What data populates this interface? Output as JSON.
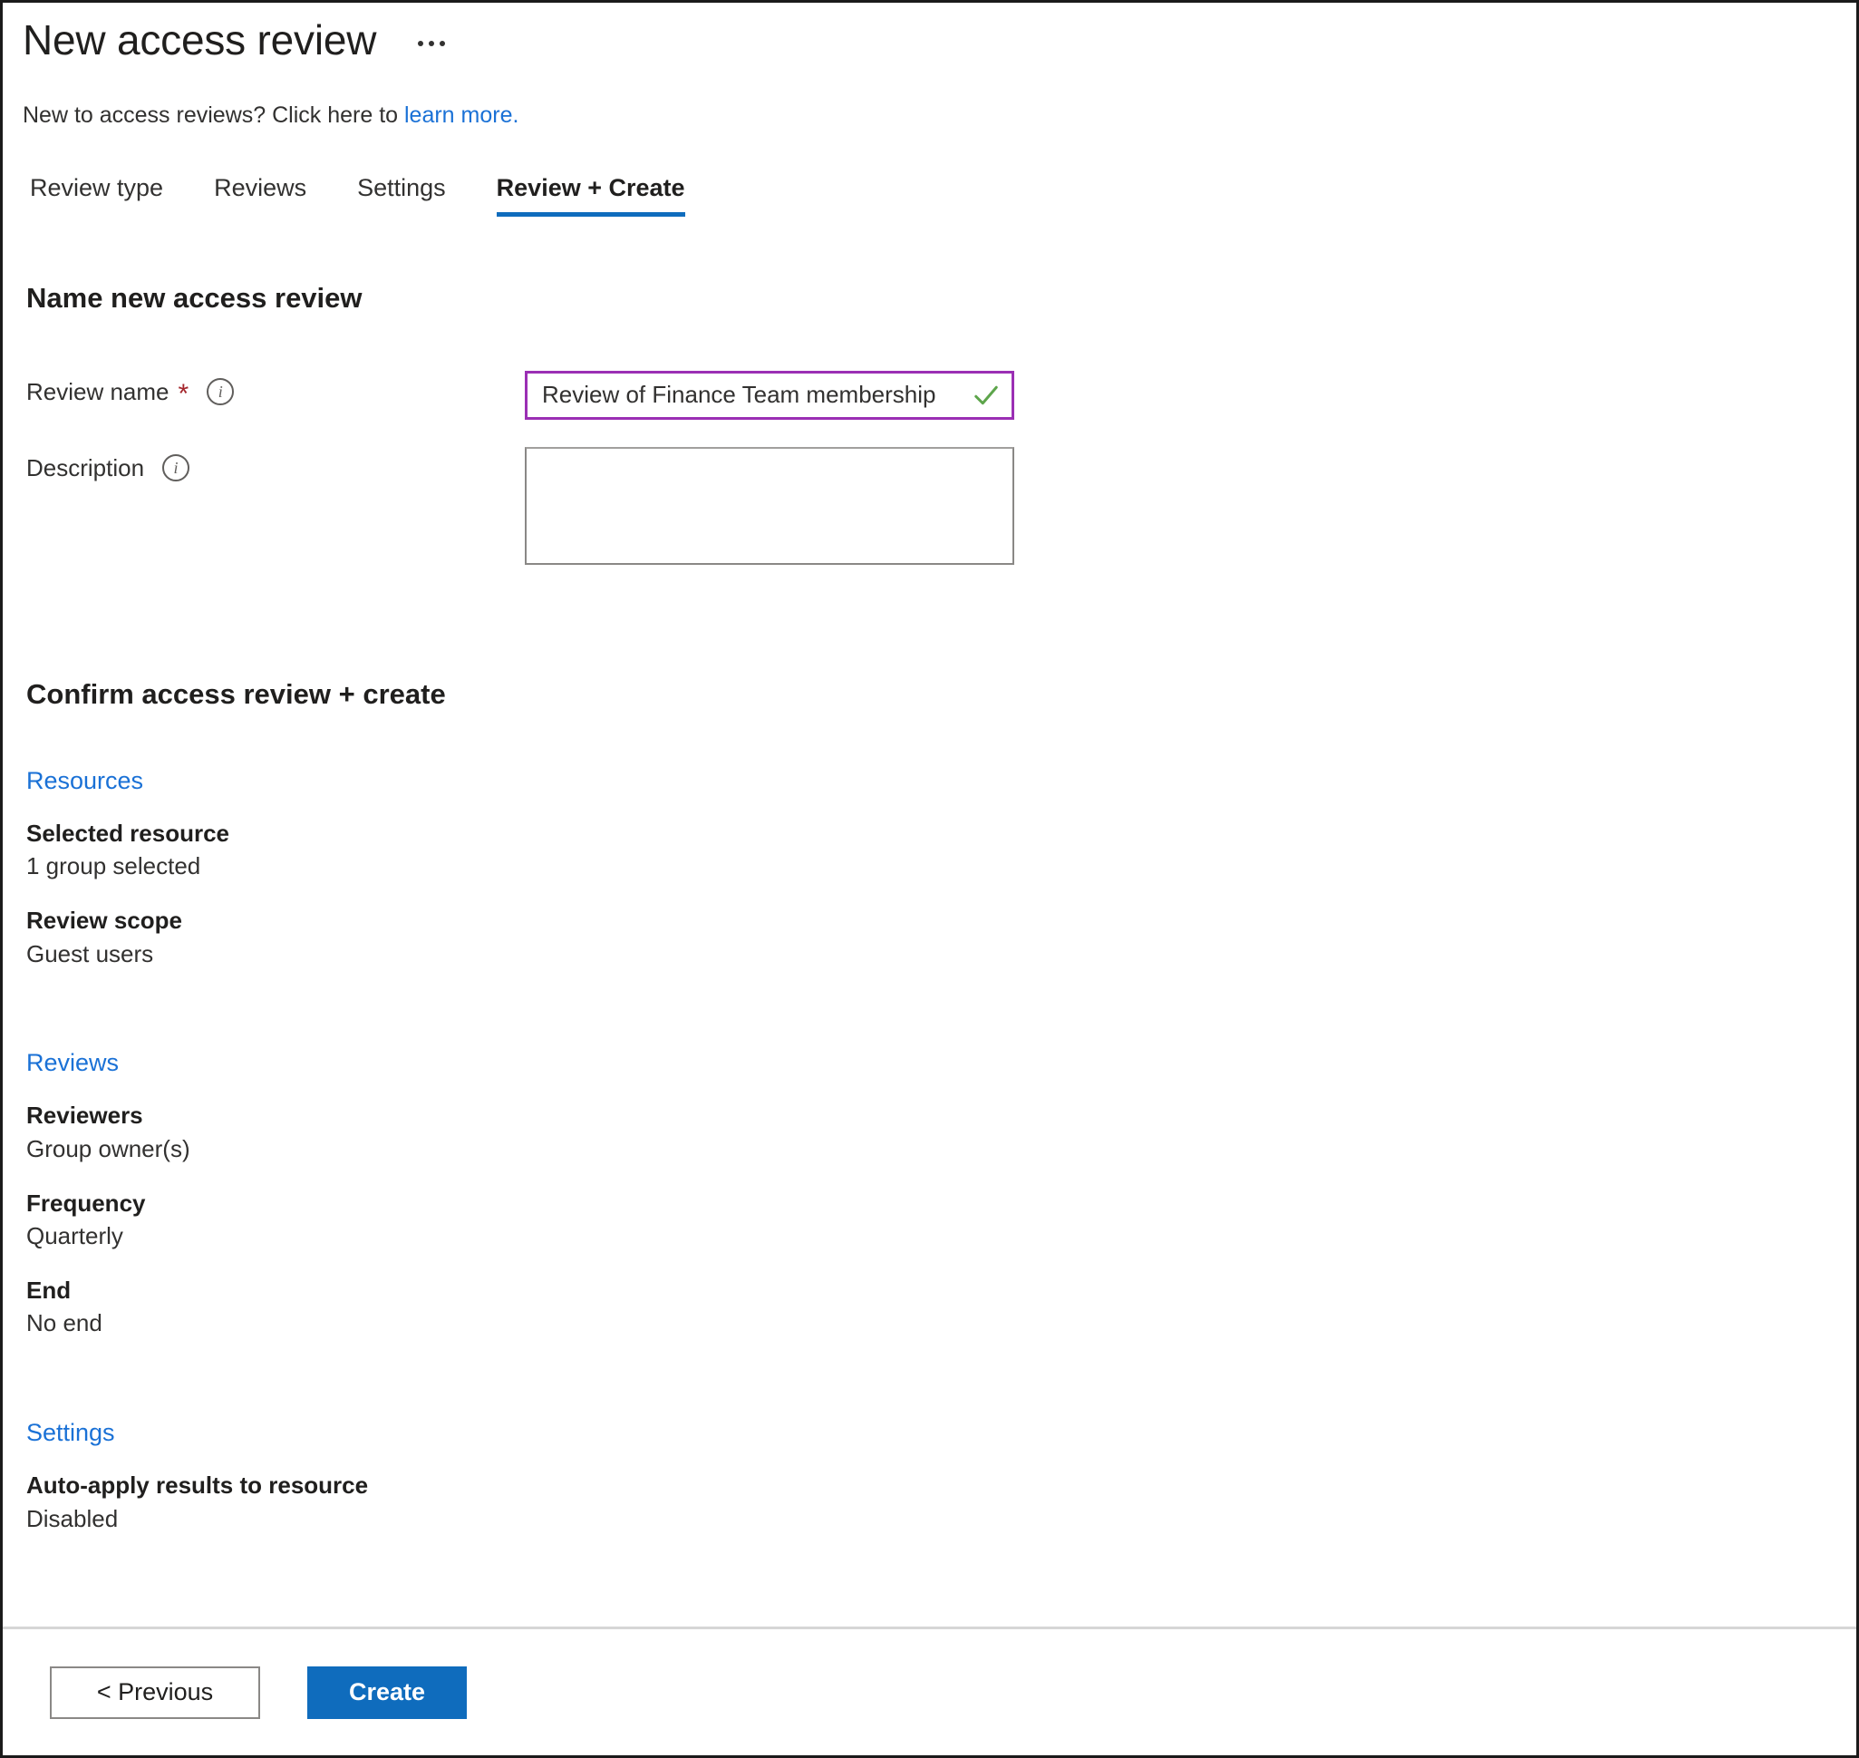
{
  "header": {
    "title": "New access review",
    "more_icon": "ellipsis-icon"
  },
  "intro": {
    "text": "New to access reviews? Click here to ",
    "link_label": "learn more."
  },
  "tabs": [
    {
      "label": "Review type",
      "active": false
    },
    {
      "label": "Reviews",
      "active": false
    },
    {
      "label": "Settings",
      "active": false
    },
    {
      "label": "Review + Create",
      "active": true
    }
  ],
  "name_section": {
    "heading": "Name new access review",
    "review_name": {
      "label": "Review name",
      "required_marker": "*",
      "info_icon": "info-icon",
      "value": "Review of Finance Team membership",
      "placeholder": "",
      "validation_icon": "checkmark-icon",
      "border_color": "#9b2fb4",
      "check_color": "#5da54b"
    },
    "description": {
      "label": "Description",
      "info_icon": "info-icon",
      "value": "",
      "placeholder": ""
    }
  },
  "confirm_section": {
    "heading": "Confirm access review + create",
    "groups": [
      {
        "link_label": "Resources",
        "items": [
          {
            "key": "Selected resource",
            "value": "1 group selected"
          },
          {
            "key": "Review scope",
            "value": "Guest users"
          }
        ]
      },
      {
        "link_label": "Reviews",
        "items": [
          {
            "key": "Reviewers",
            "value": "Group owner(s)"
          },
          {
            "key": "Frequency",
            "value": "Quarterly"
          },
          {
            "key": "End",
            "value": "No end"
          }
        ]
      },
      {
        "link_label": "Settings",
        "items": [
          {
            "key": "Auto-apply results to resource",
            "value": "Disabled"
          }
        ]
      }
    ]
  },
  "footer": {
    "previous_label": "< Previous",
    "create_label": "Create"
  },
  "colors": {
    "link_blue": "#1a71d6",
    "accent_blue": "#0f6cbd",
    "required_red": "#a4262c",
    "focus_purple": "#9b2fb4",
    "success_green": "#5da54b"
  }
}
